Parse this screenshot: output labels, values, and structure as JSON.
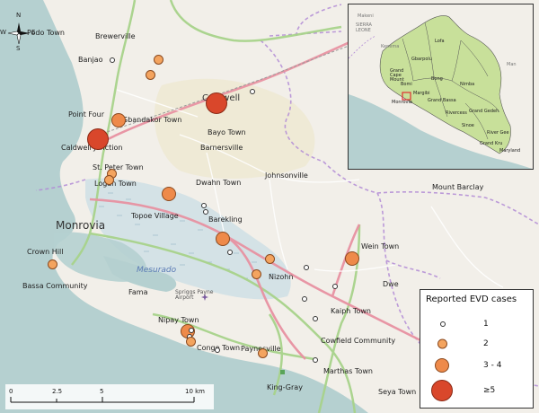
{
  "map": {
    "water_label": "Mesurado",
    "airport_label": "Spriggs Payne Airport",
    "place_labels": [
      {
        "id": "podo-town",
        "text": "Podo Town"
      },
      {
        "id": "brewerville",
        "text": "Brewerville"
      },
      {
        "id": "banjao",
        "text": "Banjao"
      },
      {
        "id": "caldwell",
        "text": "Caldwell"
      },
      {
        "id": "point-four",
        "text": "Point Four"
      },
      {
        "id": "gbandakor-town",
        "text": "Gbandakor Town"
      },
      {
        "id": "bayo-town",
        "text": "Bayo Town"
      },
      {
        "id": "caldwell-junction",
        "text": "Caldwell Junction"
      },
      {
        "id": "barnersville",
        "text": "Barnersville"
      },
      {
        "id": "st-peter-town",
        "text": "St. Peter Town"
      },
      {
        "id": "johnsonville",
        "text": "Johnsonville"
      },
      {
        "id": "logan-town",
        "text": "Logan Town"
      },
      {
        "id": "dwahn-town",
        "text": "Dwahn Town"
      },
      {
        "id": "mount-barclay",
        "text": "Mount Barclay"
      },
      {
        "id": "monrovia",
        "text": "Monrovia"
      },
      {
        "id": "topoe-village",
        "text": "Topoe Village"
      },
      {
        "id": "barekling",
        "text": "Barekling"
      },
      {
        "id": "crown-hill",
        "text": "Crown Hill"
      },
      {
        "id": "wein-town",
        "text": "Wein Town"
      },
      {
        "id": "nizohn",
        "text": "Nizohn"
      },
      {
        "id": "bassa-community",
        "text": "Bassa Community"
      },
      {
        "id": "dwe",
        "text": "Dwe"
      },
      {
        "id": "fama",
        "text": "Fama"
      },
      {
        "id": "kaiph-town",
        "text": "Kaiph Town"
      },
      {
        "id": "nipay-town",
        "text": "Nipay Town"
      },
      {
        "id": "congo-town",
        "text": "Congo Town"
      },
      {
        "id": "paynesville",
        "text": "Paynesville"
      },
      {
        "id": "cowfield-community",
        "text": "Cowfield Community"
      },
      {
        "id": "marthas-town",
        "text": "Marthas Town"
      },
      {
        "id": "king-gray",
        "text": "King-Gray"
      },
      {
        "id": "seya-town",
        "text": "Seya Town"
      }
    ],
    "case_markers": [
      {
        "place": "banjao",
        "category": "1"
      },
      {
        "place": "brewerville-east",
        "category": "2"
      },
      {
        "place": "brewerville-southeast",
        "category": "2"
      },
      {
        "place": "caldwell",
        "category": ">=5"
      },
      {
        "place": "caldwell-east",
        "category": "1"
      },
      {
        "place": "point-four",
        "category": "3 - 4"
      },
      {
        "place": "caldwell-junction",
        "category": ">=5"
      },
      {
        "place": "st-peter-town",
        "category": "2"
      },
      {
        "place": "logan-town",
        "category": "2"
      },
      {
        "place": "dwahn-town",
        "category": "3 - 4"
      },
      {
        "place": "dwahn-town-south",
        "category": "1"
      },
      {
        "place": "dwahn-town-south-2",
        "category": "1"
      },
      {
        "place": "barekling",
        "category": "3 - 4"
      },
      {
        "place": "barekling-south",
        "category": "1"
      },
      {
        "place": "crown-hill",
        "category": "2"
      },
      {
        "place": "nizohn-north",
        "category": "2"
      },
      {
        "place": "nizohn-west",
        "category": "2"
      },
      {
        "place": "nizohn-east",
        "category": "1"
      },
      {
        "place": "mount-barclay-southwest",
        "category": "1"
      },
      {
        "place": "wein-town",
        "category": "3 - 4"
      },
      {
        "place": "kaiph-town-west",
        "category": "1"
      },
      {
        "place": "kaiph-town-north",
        "category": "1"
      },
      {
        "place": "nipay-town",
        "category": "3 - 4"
      },
      {
        "place": "nipay-town-east",
        "category": "1"
      },
      {
        "place": "nipay-town-east-2",
        "category": "1"
      },
      {
        "place": "nipay-town-south",
        "category": "2"
      },
      {
        "place": "congo-town",
        "category": "1"
      },
      {
        "place": "paynesville",
        "category": "2"
      },
      {
        "place": "marthas-town",
        "category": "1"
      }
    ]
  },
  "inset": {
    "labels": {
      "makeni": "Makeni",
      "sierra_leone": "SIERRA LEONE",
      "kenema": "Kenema",
      "lofa": "Lofa",
      "gbarpolu": "Gbarpolu",
      "grand_cape_mount": "Grand Cape Mount",
      "bomi": "Bomi",
      "bong": "Bong",
      "margibi": "Margibi",
      "nimba": "Nimba",
      "grand_bassa": "Grand Bassa",
      "monrovia": "Monrovia",
      "rivercess": "Rivercess",
      "grand_gedeh": "Grand Gedeh",
      "sinoe": "Sinoe",
      "river_gee": "River Gee",
      "grand_kru": "Grand Kru",
      "maryland": "Maryland",
      "man": "Man"
    }
  },
  "legend": {
    "title": "Reported EVD cases",
    "items": [
      {
        "label": "1",
        "category": "1"
      },
      {
        "label": "2",
        "category": "2"
      },
      {
        "label": "3 - 4",
        "category": "3 - 4"
      },
      {
        "label": "≥5",
        "category": ">=5"
      }
    ]
  },
  "scale": {
    "ticks": [
      "0",
      "2.5",
      "5",
      "10 km"
    ]
  },
  "compass": {
    "north": "N",
    "south": "S",
    "east": "E",
    "west": "W"
  },
  "colors": {
    "land": "#f2efe9",
    "water": "#b5d0d0",
    "wetland": "#d4e2e6",
    "road_primary": "#e892a2",
    "road_secondary": "#a8d38b",
    "boundary": "#b28bd6",
    "marker_small": "#ffffff",
    "marker_2": "#f4a45f",
    "marker_3": "#ee8a4a",
    "marker_5": "#d9472b",
    "inset_land": "#c8e09a",
    "inset_highlight": "#e03030"
  }
}
